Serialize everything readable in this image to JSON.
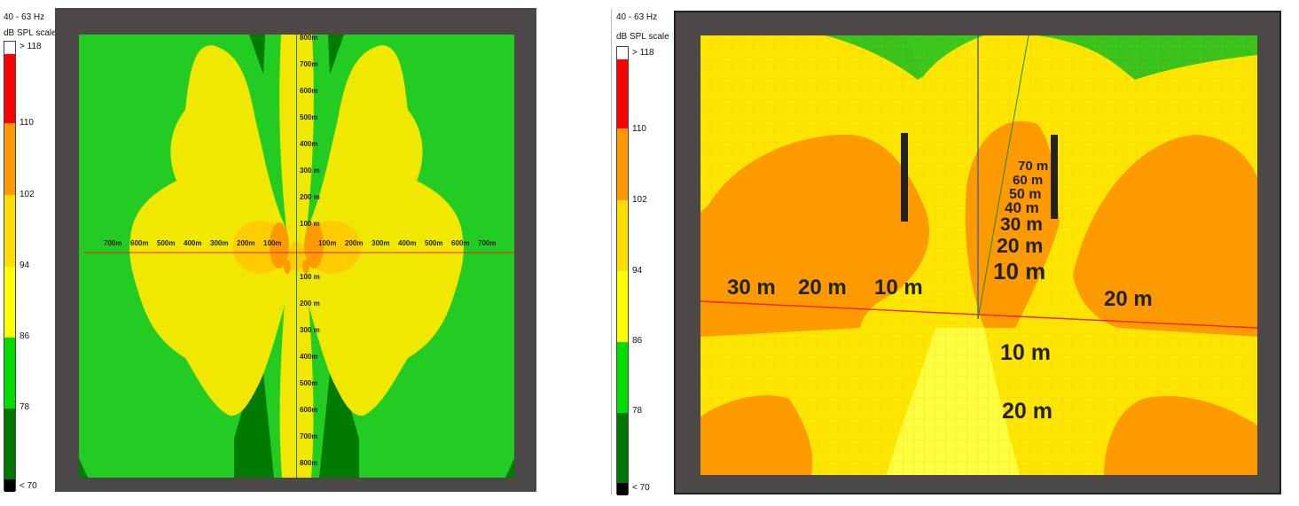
{
  "legend": {
    "band": "40 - 63 Hz",
    "title": "dB SPL scale",
    "labels": [
      "> 118",
      "110",
      "102",
      "94",
      "86",
      "78",
      "< 70"
    ],
    "colors": [
      "#ffffff",
      "#ff0000",
      "#ff9900",
      "#ffdd00",
      "#ffff00",
      "#00dd00",
      "#007700",
      "#000000"
    ]
  },
  "plan_view": {
    "x_ticks_left": [
      "700m",
      "600m",
      "500m",
      "400m",
      "300m",
      "200m",
      "100m"
    ],
    "x_ticks_right": [
      "100m",
      "200m",
      "300m",
      "400m",
      "500m",
      "600m",
      "700m"
    ],
    "y_ticks_up": [
      "800m",
      "700m",
      "600m",
      "500m",
      "400m",
      "300 m",
      "200 m",
      "100 m"
    ],
    "y_ticks_down": [
      "100 m",
      "200 m",
      "300 m",
      "400m",
      "500m",
      "600m",
      "700m",
      "800m"
    ]
  },
  "perspective_view": {
    "vertical_labels": [
      "70 m",
      "60 m",
      "50 m",
      "40 m",
      "30 m",
      "20 m",
      "10 m"
    ],
    "left_labels": [
      "30 m",
      "20 m",
      "10 m"
    ],
    "right_label": "20 m",
    "front_labels": [
      "10 m",
      "20 m"
    ]
  }
}
